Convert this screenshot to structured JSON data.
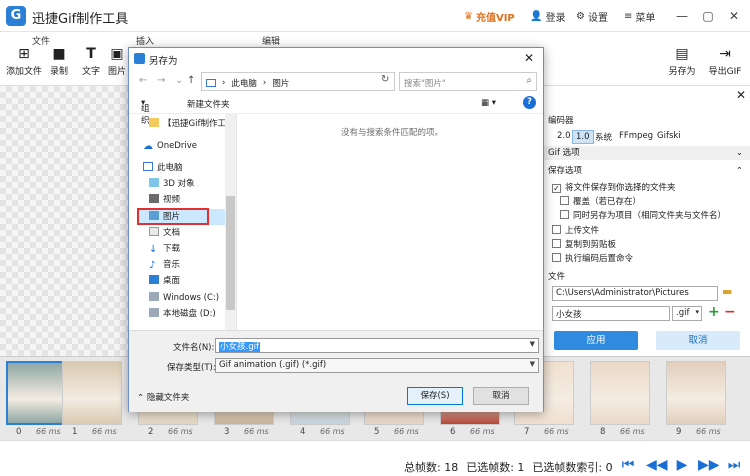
{
  "app": {
    "title": "迅捷Gif制作工具",
    "logo_letter": "G"
  },
  "titlebar": {
    "vip": "充值VIP",
    "login": "登录",
    "settings": "设置",
    "menu": "菜单"
  },
  "toolbar": {
    "tabs": [
      "文件",
      "插入",
      "编辑"
    ],
    "tools": [
      {
        "label": "添加文件",
        "icon": "add-file-icon"
      },
      {
        "label": "录制",
        "icon": "record-icon"
      },
      {
        "label": "文字",
        "icon": "text-icon"
      },
      {
        "label": "图片",
        "icon": "image-icon"
      }
    ],
    "right_tools": [
      {
        "label": "另存为",
        "icon": "save-as-icon"
      },
      {
        "label": "导出GIF",
        "icon": "export-gif-icon"
      }
    ]
  },
  "panel": {
    "encoder_label": "编码器",
    "encoders": [
      "2.0",
      "1.0",
      "系统",
      "FFmpeg",
      "Gifski"
    ],
    "selected_encoder": "1.0",
    "gif_options": "Gif 选项",
    "save_options": "保存选项",
    "options": [
      {
        "label": "将文件保存到你选择的文件夹",
        "checked": true
      },
      {
        "label": "覆盖（若已存在）",
        "checked": false
      },
      {
        "label": "同时另存为项目（相同文件夹与文件名）",
        "checked": false
      },
      {
        "label": "上传文件",
        "checked": false
      },
      {
        "label": "复制到剪贴板",
        "checked": false
      },
      {
        "label": "执行编码后置命令",
        "checked": false
      }
    ],
    "file_label": "文件",
    "folder": "C:\\Users\\Administrator\\Pictures",
    "filename": "小女孩",
    "ext": ".gif",
    "apply": "应用",
    "cancel": "取消"
  },
  "dialog": {
    "title": "另存为",
    "address": [
      "此电脑",
      "图片"
    ],
    "search_placeholder": "搜索\"图片\"",
    "organize": "组织",
    "new_folder": "新建文件夹",
    "empty": "没有与搜索条件匹配的项。",
    "nav": [
      {
        "label": "【迅捷Gif制作工",
        "icon": "folder-icon"
      },
      {
        "label": "OneDrive",
        "icon": "cloud-icon"
      },
      {
        "label": "此电脑",
        "icon": "computer-icon"
      },
      {
        "label": "3D 对象",
        "icon": "3d-objects-icon"
      },
      {
        "label": "视频",
        "icon": "video-icon"
      },
      {
        "label": "图片",
        "icon": "pictures-icon"
      },
      {
        "label": "文档",
        "icon": "documents-icon"
      },
      {
        "label": "下载",
        "icon": "download-icon"
      },
      {
        "label": "音乐",
        "icon": "music-icon"
      },
      {
        "label": "桌面",
        "icon": "desktop-icon"
      },
      {
        "label": "Windows (C:)",
        "icon": "drive-icon"
      },
      {
        "label": "本地磁盘 (D:)",
        "icon": "drive-icon"
      }
    ],
    "filename_label": "文件名(N):",
    "filename": "小女孩.gif",
    "type_label": "保存类型(T):",
    "type": "Gif animation (.gif) (*.gif)",
    "hide_folders": "隐藏文件夹",
    "save": "保存(S)",
    "cancel": "取消"
  },
  "frames": [
    {
      "n": "0",
      "ms": "66 ms"
    },
    {
      "n": "1",
      "ms": "66 ms"
    },
    {
      "n": "2",
      "ms": "66 ms"
    },
    {
      "n": "3",
      "ms": "66 ms"
    },
    {
      "n": "4",
      "ms": "66 ms"
    },
    {
      "n": "5",
      "ms": "66 ms"
    },
    {
      "n": "6",
      "ms": "66 ms"
    },
    {
      "n": "7",
      "ms": "66 ms"
    },
    {
      "n": "8",
      "ms": "66 ms"
    },
    {
      "n": "9",
      "ms": "66 ms"
    }
  ],
  "status": {
    "total": "总帧数: 18",
    "selected": "已选帧数: 1",
    "index": "已选帧数索引: 0"
  }
}
